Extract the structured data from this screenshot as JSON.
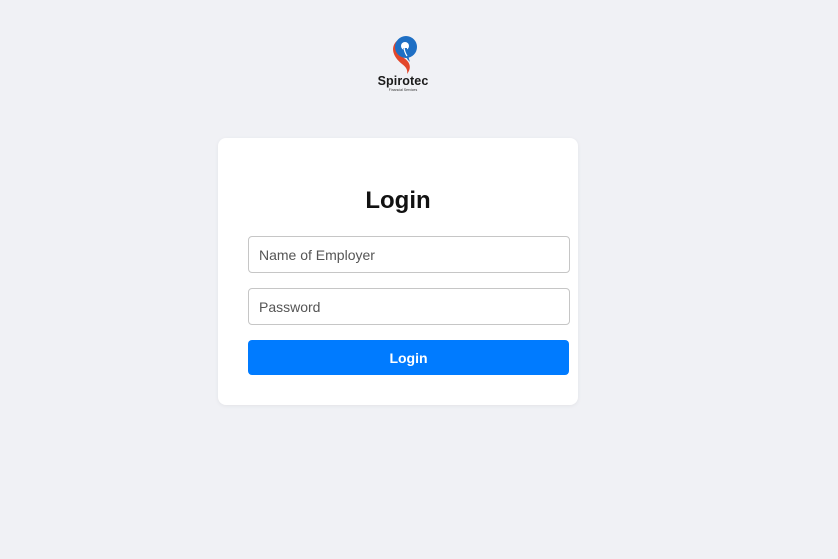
{
  "brand": {
    "name": "Spirotec",
    "tagline": "Financial Services",
    "logo_icon": "spirotec-logo-icon",
    "colors": {
      "blue": "#1e6fc4",
      "red": "#e2462a"
    }
  },
  "login": {
    "title": "Login",
    "employer_placeholder": "Name of Employer",
    "password_placeholder": "Password",
    "button_label": "Login",
    "button_color": "#007bff"
  }
}
